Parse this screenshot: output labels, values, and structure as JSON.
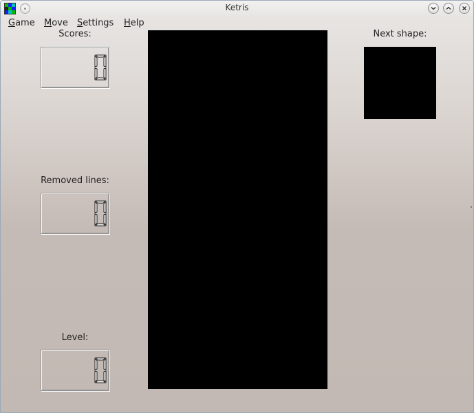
{
  "window": {
    "title": "Ketris"
  },
  "menu": {
    "items": [
      {
        "label_rest": "ame",
        "accel": "G"
      },
      {
        "label_rest": "ove",
        "accel": "M"
      },
      {
        "label_rest": "ettings",
        "accel": "S"
      },
      {
        "label_rest": "elp",
        "accel": "H"
      }
    ]
  },
  "panels": {
    "scores_label": "Scores:",
    "scores_value": "0",
    "lines_label": "Removed lines:",
    "lines_value": "0",
    "level_label": "Level:",
    "level_value": "0",
    "next_label": "Next shape:"
  },
  "colors": {
    "board": "#000000",
    "icon_cells": [
      "#00c000",
      "#1a1aff",
      "#00c0c0",
      "#202020",
      "#00c000",
      "#1a1aff",
      "#1a1aff",
      "#00c0c0",
      "#00c000"
    ]
  }
}
